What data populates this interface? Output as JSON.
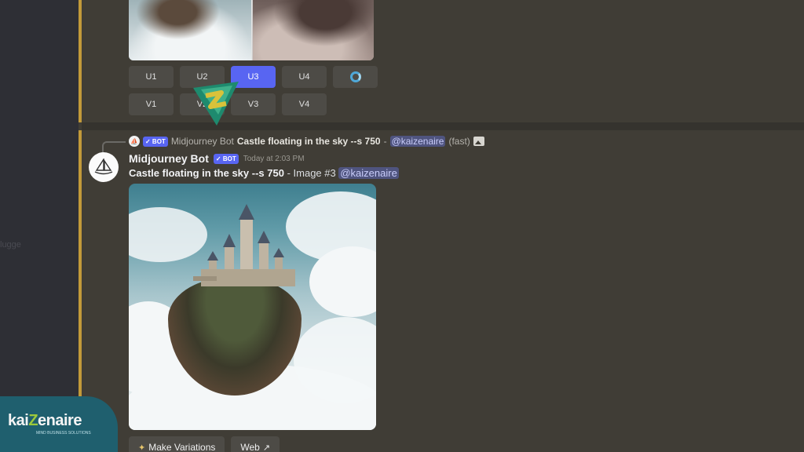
{
  "sidebar": {
    "ghost_text": "lugge"
  },
  "upscale_buttons": [
    {
      "label": "U1",
      "active": false
    },
    {
      "label": "U2",
      "active": false
    },
    {
      "label": "U3",
      "active": true
    },
    {
      "label": "U4",
      "active": false
    }
  ],
  "variation_buttons": [
    {
      "label": "V1"
    },
    {
      "label": "V2"
    },
    {
      "label": "V3"
    },
    {
      "label": "V4"
    }
  ],
  "reply": {
    "bot_tag": "✓ BOT",
    "author": "Midjourney Bot",
    "prompt": "Castle floating in the sky --s 750",
    "separator": "-",
    "mention": "@kaizenaire",
    "speed": "(fast)"
  },
  "message": {
    "username": "Midjourney Bot",
    "bot_tag": "✓ BOT",
    "timestamp": "Today at 2:03 PM",
    "prompt": "Castle floating in the sky --s 750",
    "image_label": "- Image #3",
    "mention": "@kaizenaire"
  },
  "actions": {
    "make_variations": "Make Variations",
    "web": "Web"
  },
  "watermark": {
    "logo_text_a": "kai",
    "logo_text_z": "Z",
    "logo_text_b": "enaire",
    "tagline": "MIND BUSINESS SOLUTIONS"
  },
  "colors": {
    "background": "#403d36",
    "accent": "#5865f2",
    "mention_bar": "#c29a3a"
  }
}
